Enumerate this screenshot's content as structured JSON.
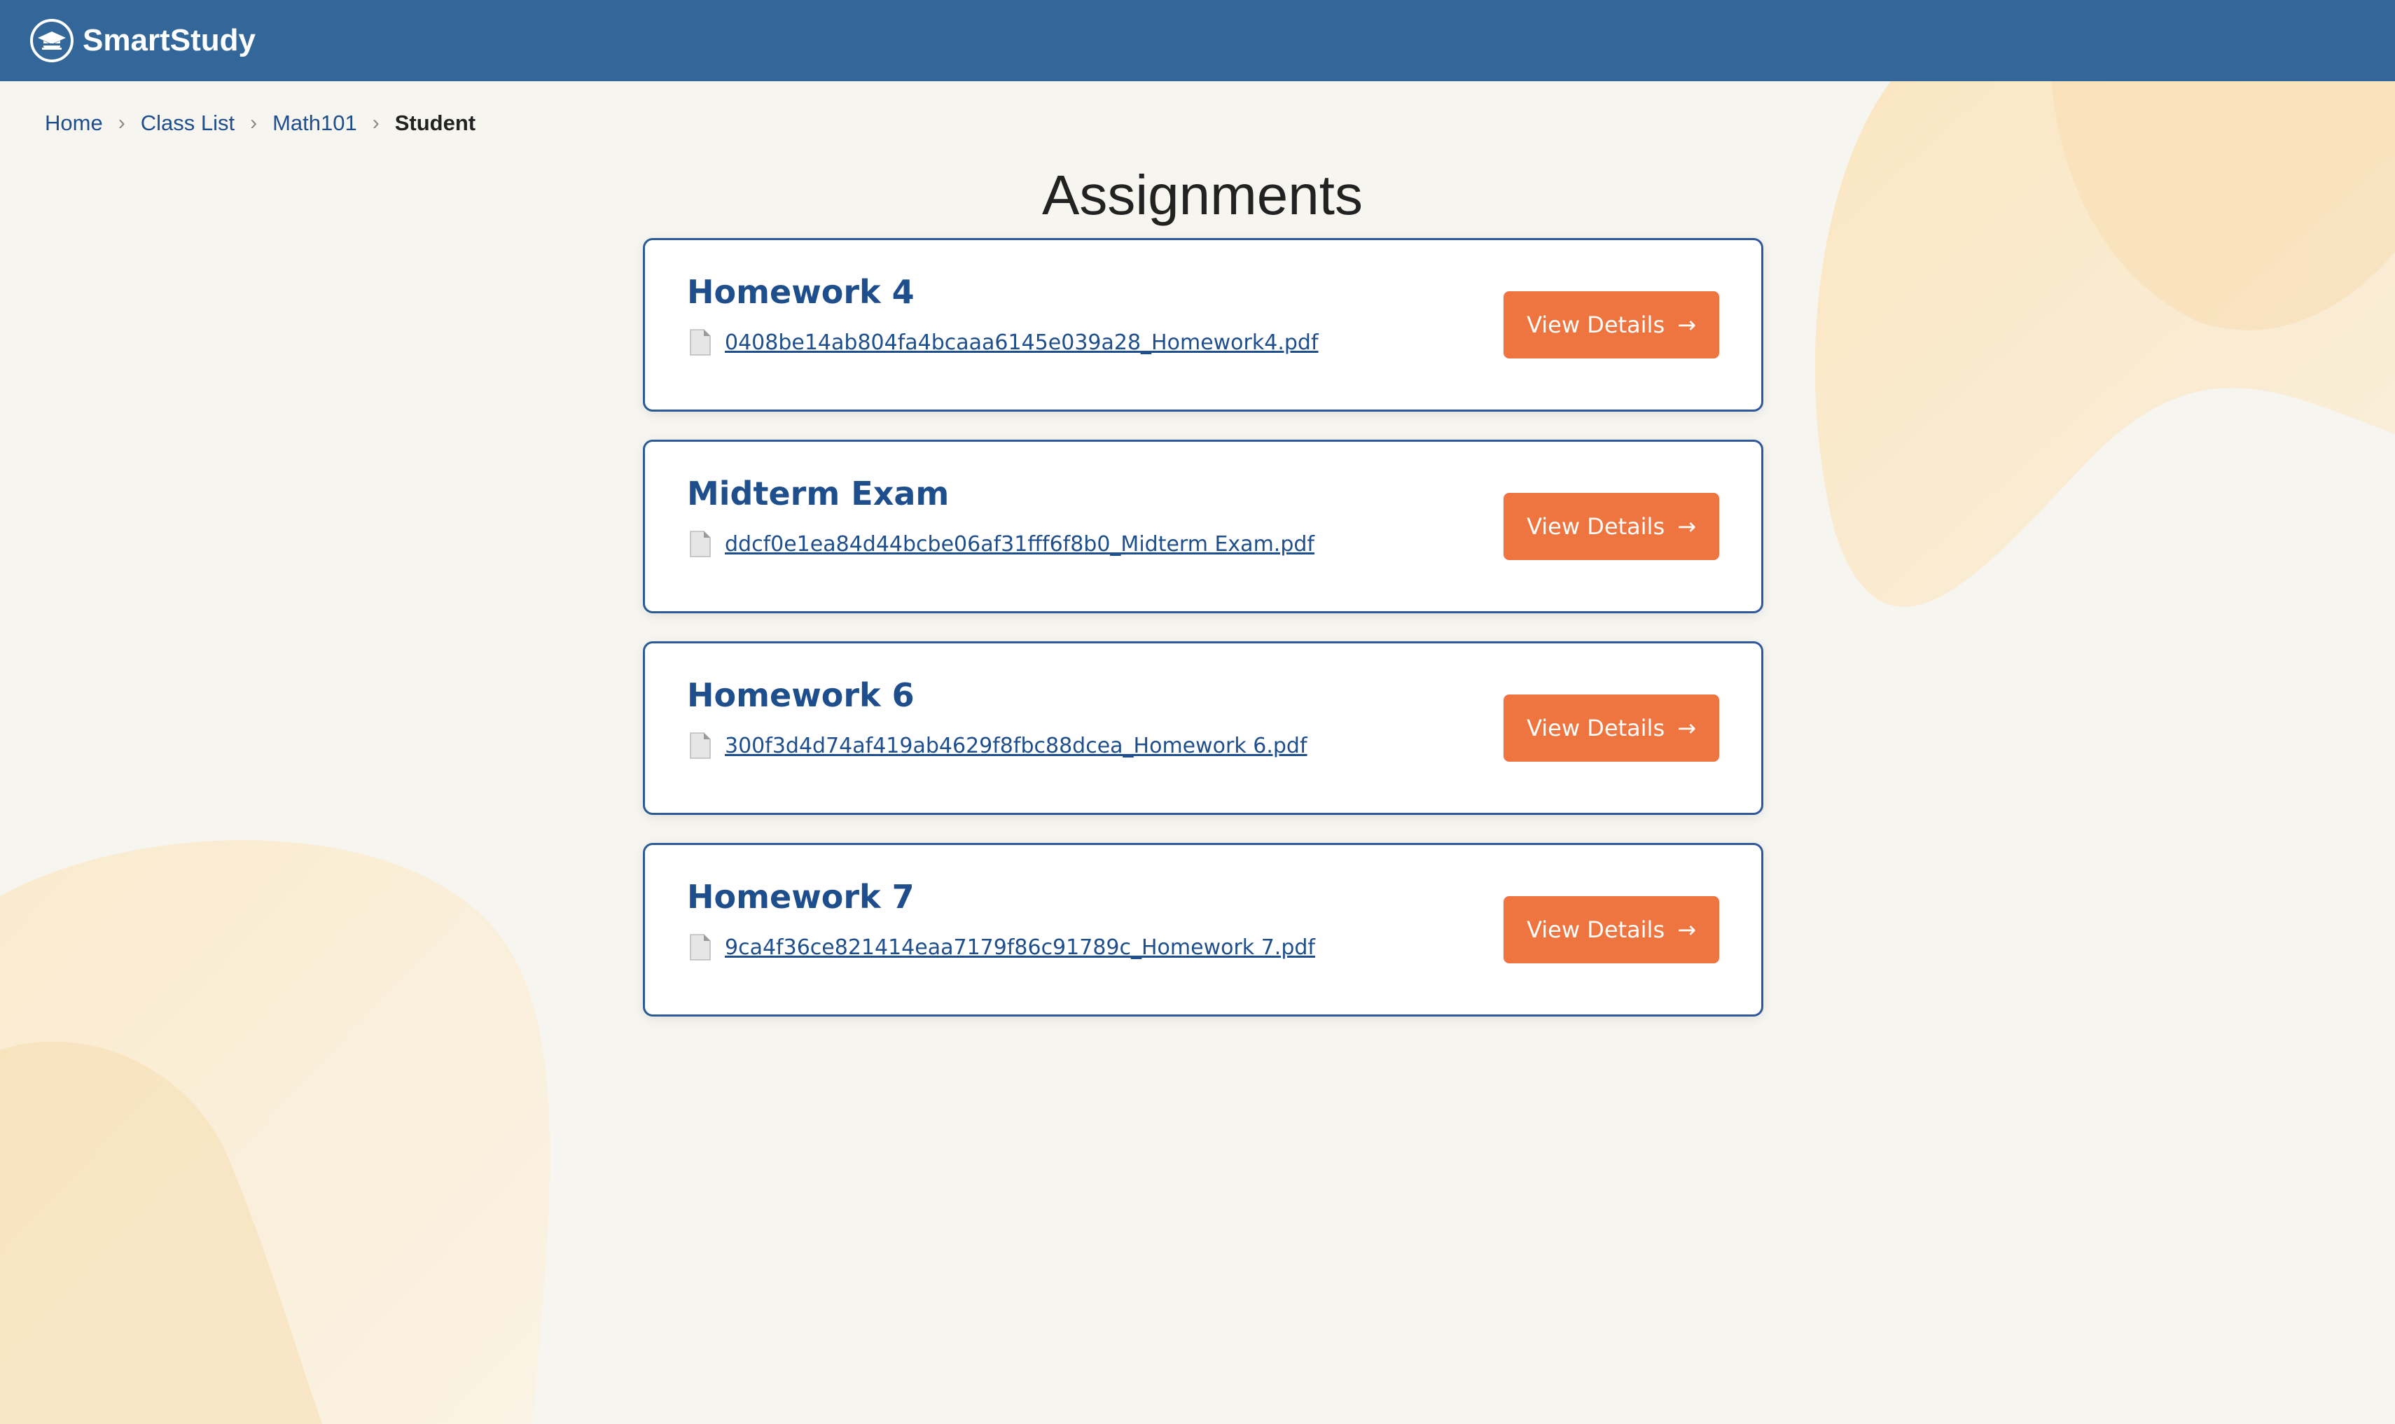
{
  "header": {
    "brand": "SmartStudy",
    "logo_icon": "graduation-cap-icon",
    "background": "#336699"
  },
  "breadcrumb": {
    "items": [
      "Home",
      "Class List",
      "Math101"
    ],
    "current": "Student",
    "separator": "›"
  },
  "page": {
    "title": "Assignments"
  },
  "assignments": [
    {
      "title": "Homework 4",
      "file": "0408be14ab804fa4bcaaa6145e039a28_Homework4.pdf",
      "button_label": "View Details",
      "button_arrow": "→"
    },
    {
      "title": "Midterm Exam",
      "file": "ddcf0e1ea84d44bcbe06af31fff6f8b0_Midterm Exam.pdf",
      "button_label": "View Details",
      "button_arrow": "→"
    },
    {
      "title": "Homework 6",
      "file": "300f3d4d74af419ab4629f8fbc88dcea_Homework 6.pdf",
      "button_label": "View Details",
      "button_arrow": "→"
    },
    {
      "title": "Homework 7",
      "file": "9ca4f36ce821414eaa7179f86c91789c_Homework 7.pdf",
      "button_label": "View Details",
      "button_arrow": "→"
    }
  ],
  "colors": {
    "accent": "#ee7540",
    "link": "#1f4e8c",
    "card_border": "#2b5a97",
    "page_background": "#f7f5f0"
  },
  "icons": {
    "file": "file-icon"
  }
}
